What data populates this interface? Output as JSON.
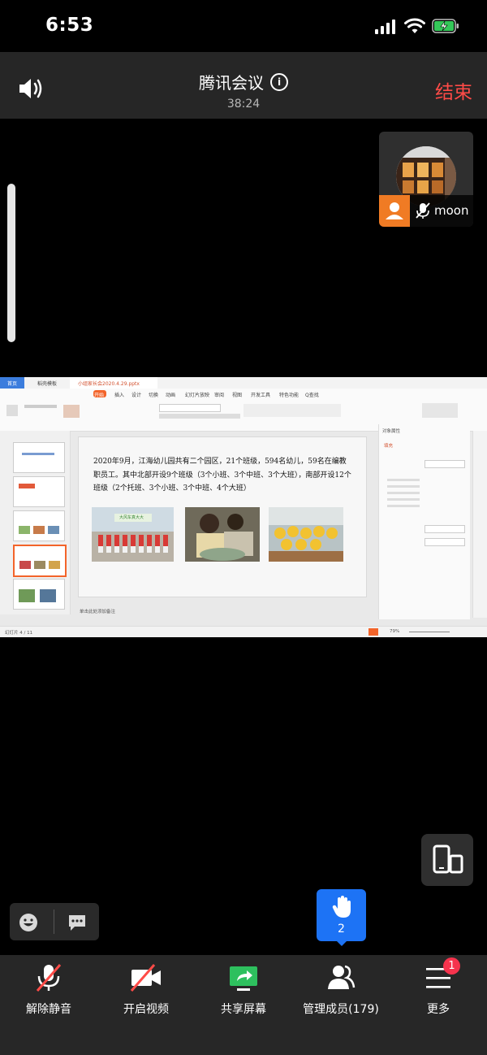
{
  "status_bar": {
    "time": "6:53"
  },
  "header": {
    "title": "腾讯会议",
    "duration": "38:24",
    "end_label": "结束"
  },
  "participant": {
    "name": "moon"
  },
  "shared_screen": {
    "app_tabs": [
      "首页",
      "稻壳模板",
      "小组家长会2020.4.29.pptx"
    ],
    "ribbon_tabs": [
      "开始",
      "插入",
      "设计",
      "切换",
      "动画",
      "幻灯片放映",
      "审阅",
      "视图",
      "开发工具",
      "特色功能",
      "Q查找"
    ],
    "slide_text": "2020年9月，江海幼儿园共有二个园区，21个班级，594名幼儿，59名在编教职员工。其中北部开设9个班级（3个小班、3个中班、3个大班），南部开设12个班级（2个托班、3个小班、3个中班、4个大班）",
    "photo_caption": "大风车真大大",
    "notes_placeholder": "单击此处添加备注",
    "status_left": "幻灯片 4 / 11",
    "zoom": "79%",
    "panel": {
      "title": "对象属性",
      "tab": "填充"
    }
  },
  "raise_hand": {
    "count": "2"
  },
  "toolbar": {
    "unmute_label": "解除静音",
    "video_label": "开启视频",
    "share_label": "共享屏幕",
    "members_label": "管理成员(179)",
    "more_label": "更多",
    "more_badge": "1"
  },
  "colors": {
    "end": "#ff4b47",
    "accent_blue": "#1d73f5",
    "share_green": "#2ec05e",
    "badge_red": "#f5334d",
    "host_orange": "#f07b24"
  },
  "icons": [
    "speaker-icon",
    "info-icon",
    "host-icon",
    "mic-off-icon",
    "switch-device-icon",
    "emoji-icon",
    "chat-icon",
    "raise-hand-icon",
    "mic-muted-icon",
    "video-off-icon",
    "share-screen-icon",
    "members-icon",
    "more-menu-icon"
  ]
}
